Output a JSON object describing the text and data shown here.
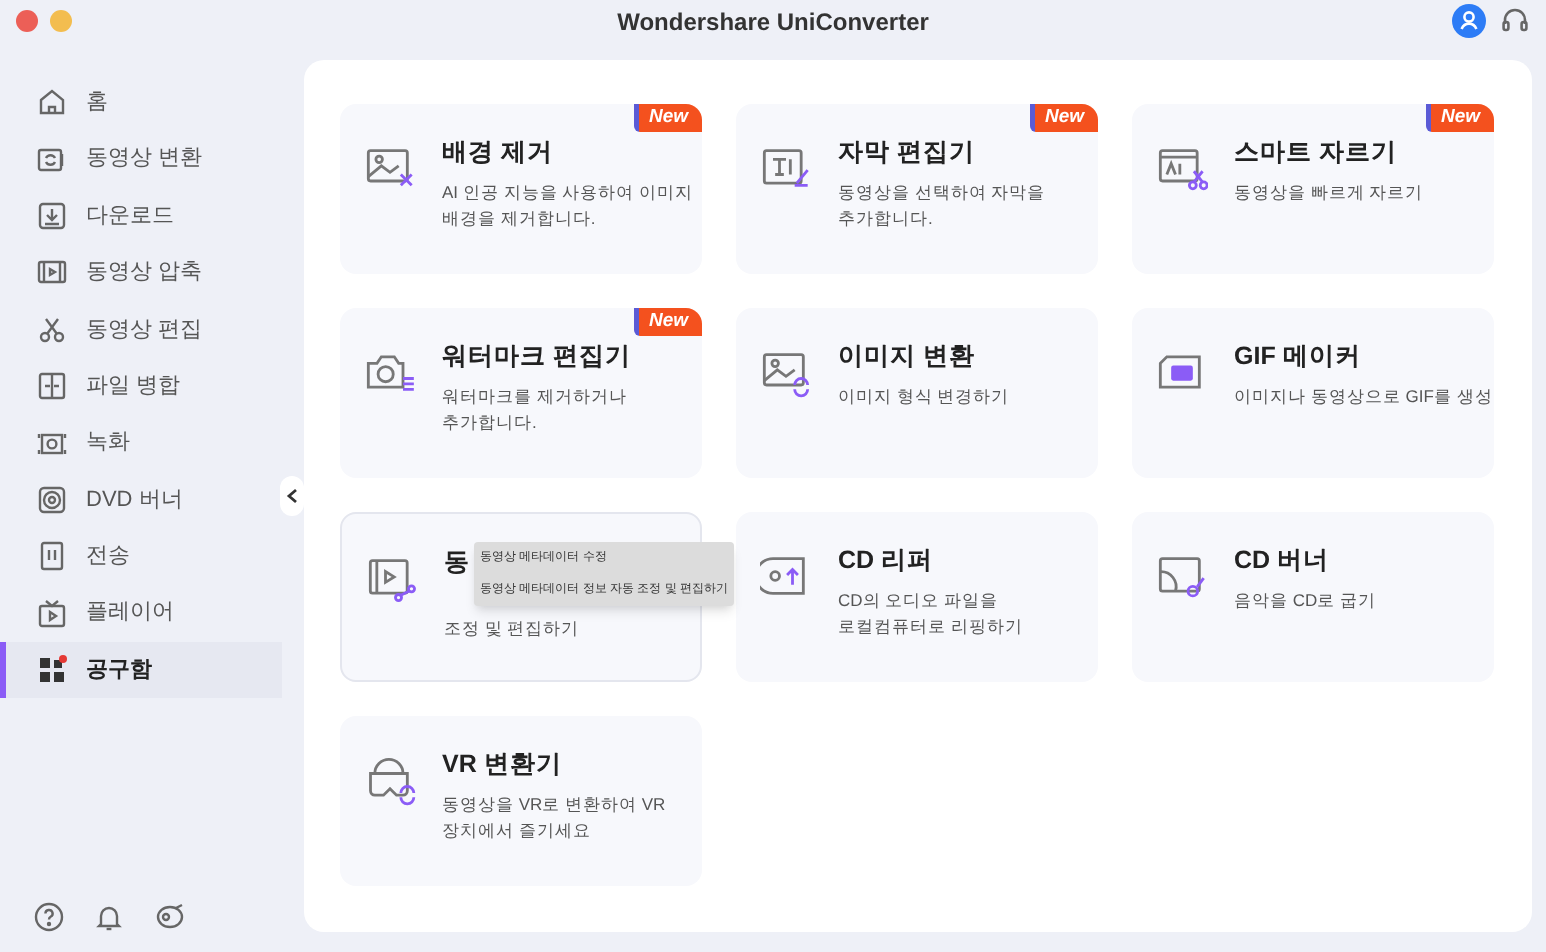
{
  "window": {
    "title": "Wondershare UniConverter"
  },
  "sidebar": {
    "items": [
      {
        "label": "홈",
        "selected": false
      },
      {
        "label": "동영상 변환",
        "selected": false
      },
      {
        "label": "다운로드",
        "selected": false
      },
      {
        "label": "동영상 압축",
        "selected": false
      },
      {
        "label": "동영상 편집",
        "selected": false
      },
      {
        "label": "파일 병합",
        "selected": false
      },
      {
        "label": "녹화",
        "selected": false
      },
      {
        "label": "DVD 버너",
        "selected": false
      },
      {
        "label": "전송",
        "selected": false
      },
      {
        "label": "플레이어",
        "selected": false
      },
      {
        "label": "공구함",
        "selected": true
      }
    ]
  },
  "tools": [
    {
      "title": "배경 제거",
      "description": [
        "AI 인공 지능을 사용하여 이미지",
        "배경을 제거합니다."
      ],
      "badge": "New"
    },
    {
      "title": "자막 편집기",
      "description": [
        "동영상을 선택하여 자막을",
        "추가합니다."
      ],
      "badge": "New"
    },
    {
      "title": "스마트 자르기",
      "description": [
        "동영상을 빠르게 자르기"
      ],
      "badge": "New"
    },
    {
      "title": "워터마크 편집기",
      "description": [
        "워터마크를 제거하거나",
        "추가합니다."
      ],
      "badge": "New"
    },
    {
      "title": "이미지 변환",
      "description": [
        "이미지 형식 변경하기"
      ]
    },
    {
      "title": "GIF 메이커",
      "description": [
        "이미지나 동영상으로 GIF를 생성"
      ]
    },
    {
      "title": "동",
      "description": [
        "조정 및 편집하기"
      ],
      "tooltip": [
        "동영상 메타데이터 수정",
        "동영상 메타데이터 정보 자동 조정 및 편집하기"
      ]
    },
    {
      "title": "CD 리퍼",
      "description": [
        "CD의 오디오 파일을",
        "로컬컴퓨터로 리핑하기"
      ]
    },
    {
      "title": "CD 버너",
      "description": [
        "음악을 CD로 굽기"
      ]
    },
    {
      "title": "VR 변환기",
      "description": [
        "동영상을 VR로 변환하여 VR",
        "장치에서 즐기세요"
      ]
    }
  ]
}
